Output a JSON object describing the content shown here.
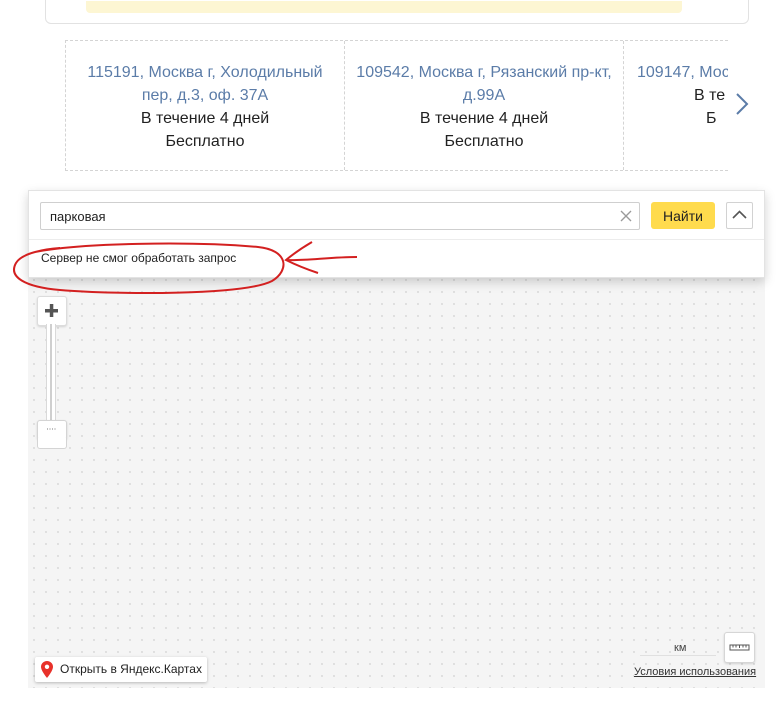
{
  "delivery_points": [
    {
      "address": "115191, Москва г, Холодильный пер, д.3, оф. 37А",
      "term": "В течение 4 дней",
      "price": "Бесплатно"
    },
    {
      "address": "109542, Москва г, Рязанский пр-кт, д.99А",
      "term": "В течение 4 дней",
      "price": "Бесплатно"
    },
    {
      "address": "109147, Мос",
      "term": "В те",
      "price": "Б"
    }
  ],
  "search": {
    "value": "парковая",
    "find_label": "Найти",
    "error_message": "Сервер не смог обработать запрос"
  },
  "map": {
    "open_in_maps_label": "Открыть в Яндекс.Картах",
    "scale_unit": "км",
    "terms_label": "Условия использования"
  },
  "colors": {
    "accent_button": "#ffdb4d",
    "address_link": "#5b7ca8",
    "annotation_red": "#d32020",
    "notice_bg": "#fdf6d3"
  },
  "icons": {
    "clear": "close-icon",
    "collapse": "chevron-up-icon",
    "next": "chevron-right-icon",
    "zoom_in": "plus-icon",
    "pin": "map-pin-icon",
    "ruler": "ruler-icon"
  }
}
